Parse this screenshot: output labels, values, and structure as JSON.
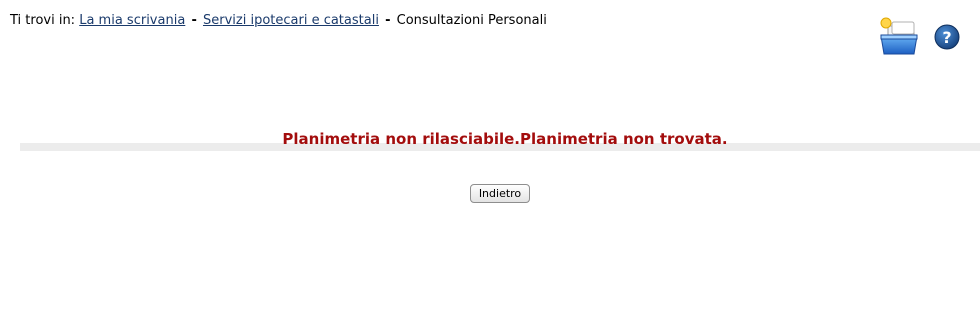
{
  "breadcrumb": {
    "prefix": "Ti trovi in:",
    "items": [
      {
        "label": "La mia scrivania"
      },
      {
        "label": "Servizi ipotecari e catastali"
      }
    ],
    "separator": "-",
    "current": "Consultazioni Personali"
  },
  "toolbar": {
    "icons": [
      "briefcase-icon",
      "help-icon"
    ]
  },
  "message": {
    "text": "Planimetria non rilasciabile.Planimetria non trovata.",
    "color": "#a30d0d"
  },
  "actions": {
    "back_label": "Indietro"
  }
}
